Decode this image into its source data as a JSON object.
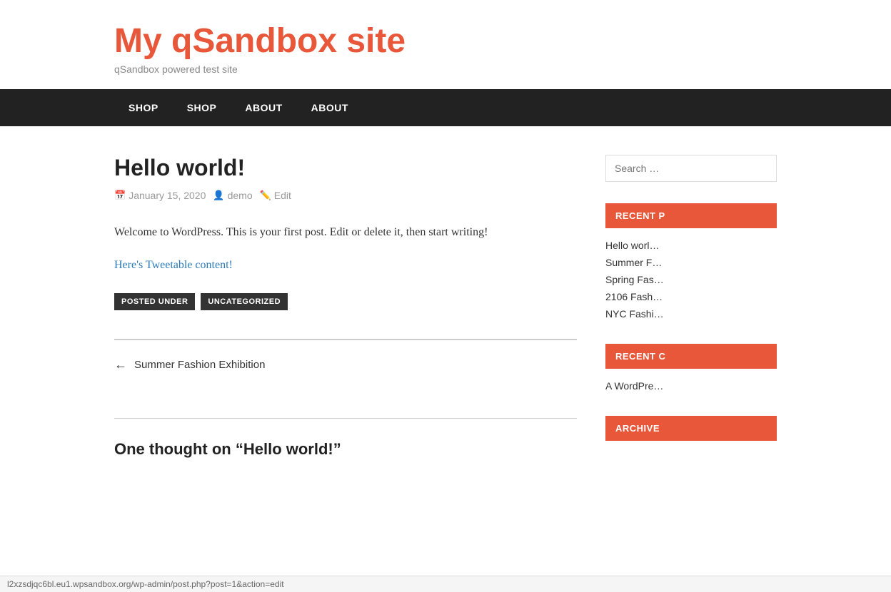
{
  "site": {
    "title": "My qSandbox site",
    "tagline": "qSandbox powered test site"
  },
  "nav": {
    "items": [
      {
        "label": "SHOP",
        "href": "#"
      },
      {
        "label": "SHOP",
        "href": "#"
      },
      {
        "label": "ABOUT",
        "href": "#"
      },
      {
        "label": "ABOUT",
        "href": "#"
      }
    ]
  },
  "post": {
    "title": "Hello world!",
    "date": "January 15, 2020",
    "author": "demo",
    "edit_label": "Edit",
    "body": "Welcome to WordPress. This is your first post. Edit or delete it, then start writing!",
    "tweetable_text": "Here's Tweetable content!",
    "posted_under_label": "POSTED UNDER",
    "category": "UNCATEGORIZED"
  },
  "post_nav": {
    "prev_label": "Summer Fashion Exhibition"
  },
  "comments": {
    "title": "One thought on “Hello world!”"
  },
  "sidebar": {
    "search_placeholder": "Search …",
    "recent_posts_title": "RECENT P",
    "recent_posts": [
      {
        "label": "Hello worl…"
      },
      {
        "label": "Summer F…"
      },
      {
        "label": "Spring Fas…"
      },
      {
        "label": "2106 Fash…"
      },
      {
        "label": "NYC Fashi…"
      }
    ],
    "recent_comments_title": "RECENT C",
    "recent_comments": [
      {
        "label": "A WordPre…"
      }
    ],
    "archives_title": "ARCHIVE"
  },
  "status_bar": {
    "url": "l2xzsdjqc6bl.eu1.wpsandbox.org/wp-admin/post.php?post=1&action=edit"
  },
  "colors": {
    "accent": "#e8573a",
    "nav_bg": "#222222",
    "tag_bg": "#333333"
  }
}
